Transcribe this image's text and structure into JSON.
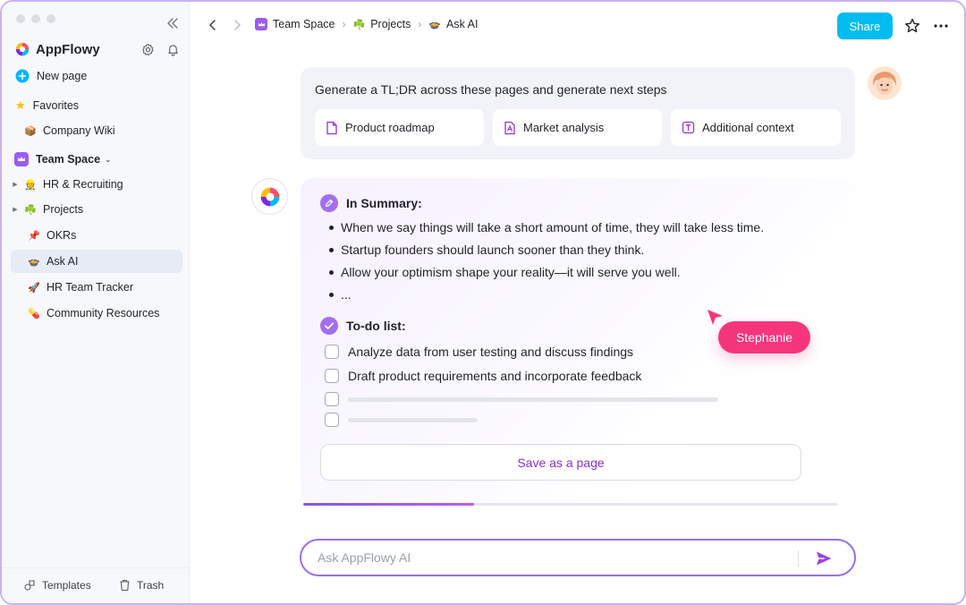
{
  "sidebar": {
    "brand": "AppFlowy",
    "new_page": "New page",
    "favorites_label": "Favorites",
    "favorites": [
      {
        "emoji": "📦",
        "label": "Company Wiki"
      }
    ],
    "space_label": "Team Space",
    "items": [
      {
        "emoji": "👷",
        "label": "HR & Recruiting"
      },
      {
        "emoji": "☘️",
        "label": "Projects"
      },
      {
        "emoji": "📌",
        "label": "OKRs"
      },
      {
        "emoji": "🍲",
        "label": "Ask AI"
      },
      {
        "emoji": "🚀",
        "label": "HR Team Tracker"
      },
      {
        "emoji": "💊",
        "label": "Community Resources"
      }
    ],
    "footer": {
      "templates": "Templates",
      "trash": "Trash"
    }
  },
  "topbar": {
    "breadcrumb": [
      {
        "emoji": "",
        "label": "Team Space"
      },
      {
        "emoji": "☘️",
        "label": "Projects"
      },
      {
        "emoji": "🍲",
        "label": "Ask AI"
      }
    ],
    "share_label": "Share"
  },
  "prompt": {
    "text": "Generate a TL;DR across these pages and generate next steps",
    "chips": [
      "Product roadmap",
      "Market analysis",
      "Additional context"
    ]
  },
  "response": {
    "summary_title": "In Summary:",
    "bullets": [
      "When we say things will take a short amount of time, they will take less time.",
      "Startup founders should launch sooner than they think.",
      "Allow your optimism shape your reality—it will serve you well.",
      "..."
    ],
    "todo_title": "To-do list:",
    "todos": [
      "Analyze data from user testing and discuss findings",
      "Draft product requirements and incorporate feedback"
    ],
    "save_label": "Save as a page",
    "progress": 0.32
  },
  "cursor_user": "Stephanie",
  "input": {
    "placeholder": "Ask AppFlowy AI",
    "value": ""
  },
  "colors": {
    "accent": "#00bcf0",
    "purple": "#8a2fd6",
    "cursor": "#f5357c"
  }
}
